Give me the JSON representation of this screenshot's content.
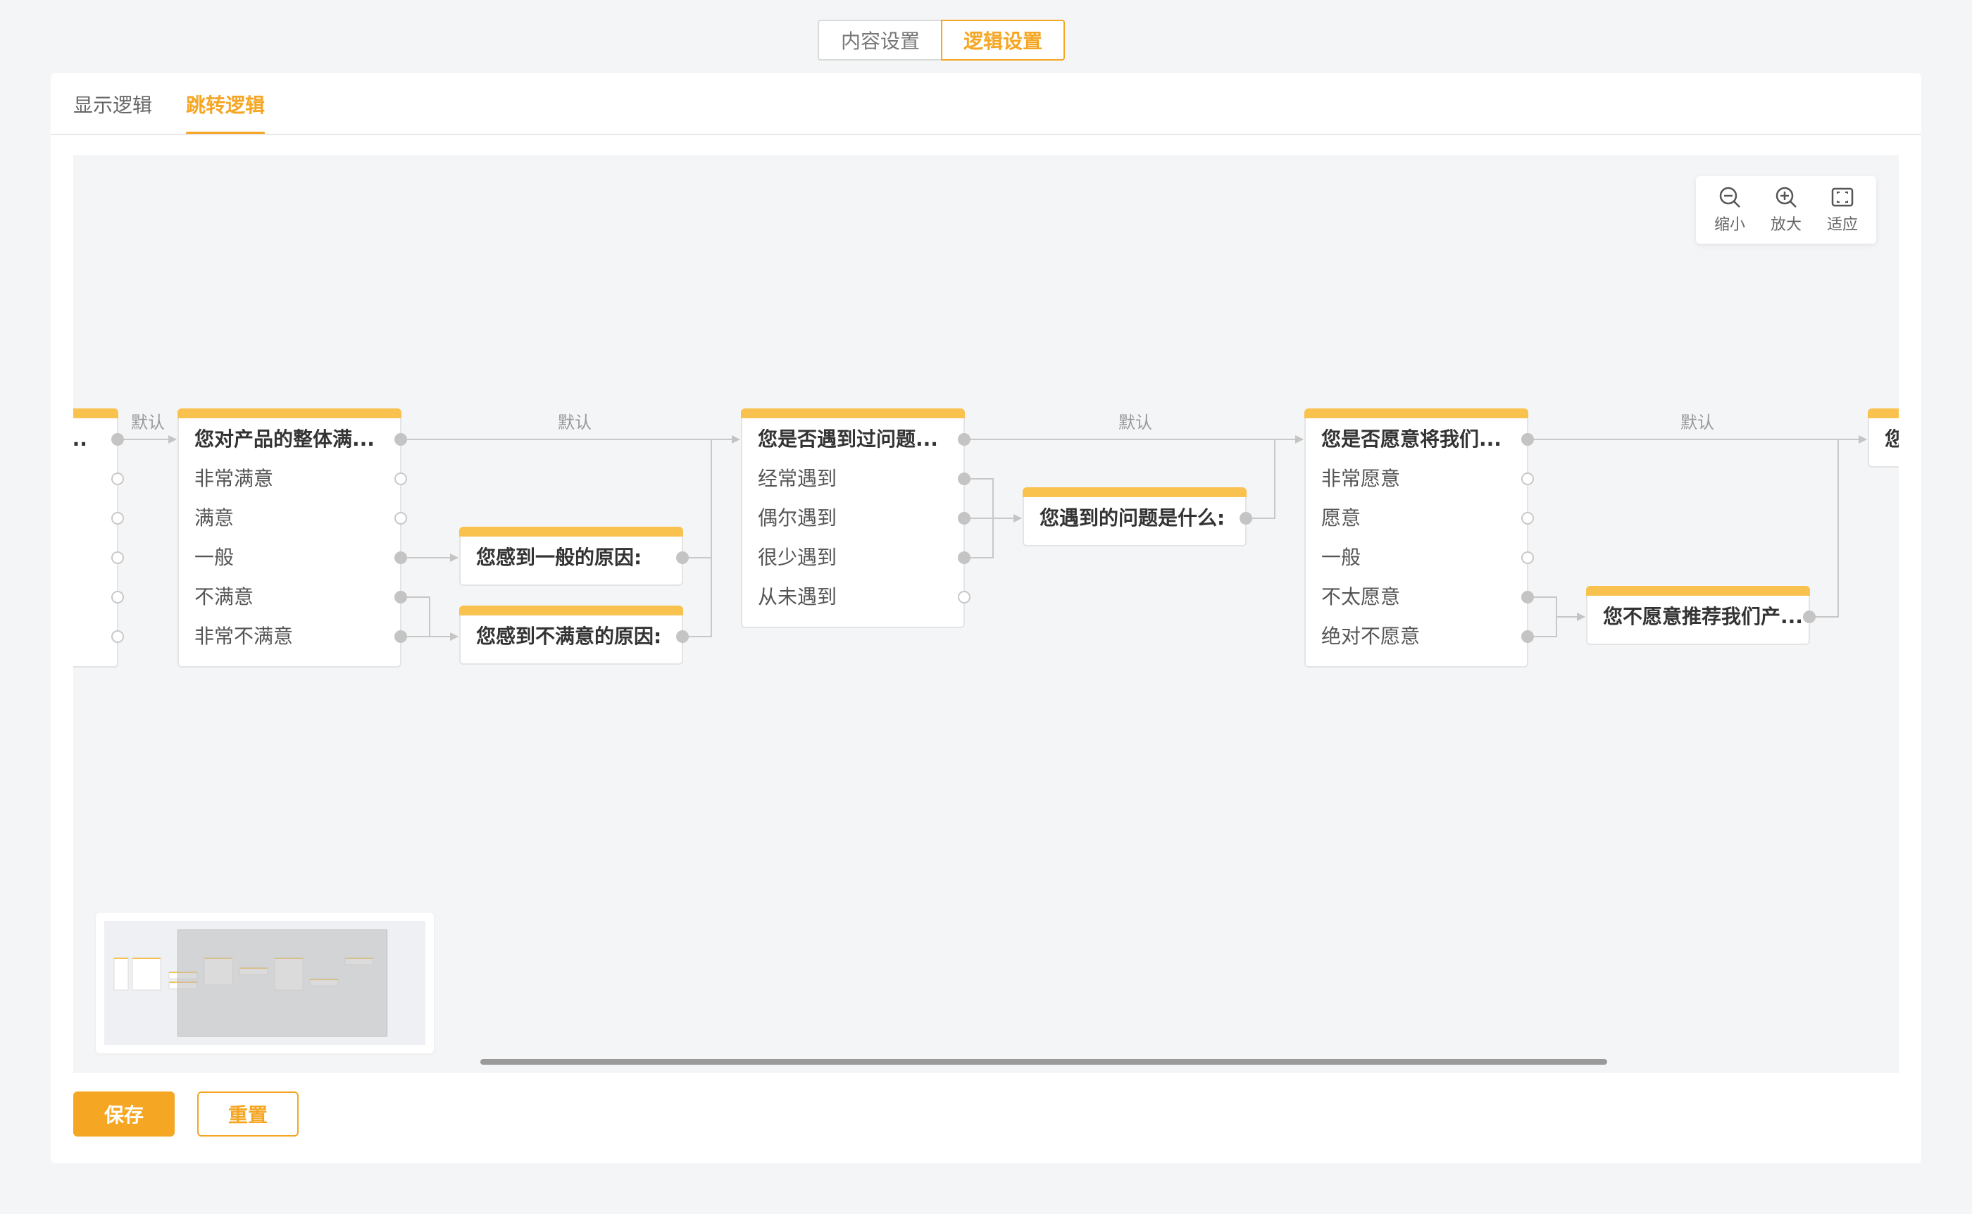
{
  "top_tabs": {
    "content": "内容设置",
    "logic": "逻辑设置"
  },
  "sub_tabs": {
    "display": "显示逻辑",
    "jump": "跳转逻辑"
  },
  "edge_label": "默认",
  "toolbar": {
    "zoom_out": "缩小",
    "zoom_in": "放大",
    "fit": "适应"
  },
  "nodes": {
    "partial_left": {
      "title": "..."
    },
    "q_satisfaction": {
      "title": "您对产品的整体满...",
      "options": [
        "非常满意",
        "满意",
        "一般",
        "不满意",
        "非常不满意"
      ]
    },
    "q_reason_general": {
      "title": "您感到一般的原因:"
    },
    "q_reason_unsatisfied": {
      "title": "您感到不满意的原因:"
    },
    "q_problems": {
      "title": "您是否遇到过问题...",
      "options": [
        "经常遇到",
        "偶尔遇到",
        "很少遇到",
        "从未遇到"
      ]
    },
    "q_problem_what": {
      "title": "您遇到的问题是什么:"
    },
    "q_recommend": {
      "title": "您是否愿意将我们...",
      "options": [
        "非常愿意",
        "愿意",
        "一般",
        "不太愿意",
        "绝对不愿意"
      ]
    },
    "q_not_recommend": {
      "title": "您不愿意推荐我们产..."
    },
    "partial_right": {
      "title": "您"
    }
  },
  "buttons": {
    "save": "保存",
    "reset": "重置"
  },
  "colors": {
    "accent": "#f5a623",
    "node_header": "#f9c14e",
    "edge": "#c4c4c4"
  }
}
